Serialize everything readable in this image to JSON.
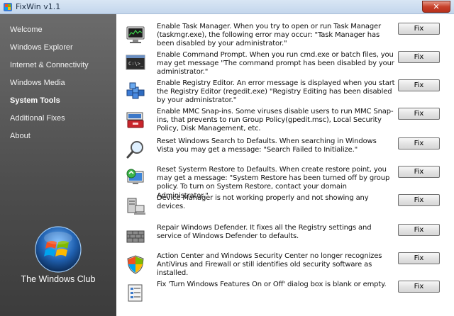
{
  "window": {
    "title": "FixWin v1.1",
    "close_label": "✕"
  },
  "sidebar": {
    "items": [
      {
        "label": "Welcome",
        "active": false
      },
      {
        "label": "Windows Explorer",
        "active": false
      },
      {
        "label": "Internet & Connectivity",
        "active": false
      },
      {
        "label": "Windows Media",
        "active": false
      },
      {
        "label": "System Tools",
        "active": true
      },
      {
        "label": "Additional Fixes",
        "active": false
      },
      {
        "label": "About",
        "active": false
      }
    ],
    "brand": "The Windows Club"
  },
  "fixes": [
    {
      "icon": "task-manager-icon",
      "text": "Enable Task Manager. When you try to open or run Task Manager (taskmgr.exe), the following error may occur: \"Task Manager has been disabled by your administrator.\"",
      "button": "Fix"
    },
    {
      "icon": "command-prompt-icon",
      "text": "Enable Command Prompt. When you run cmd.exe or batch files, you may get message \"The command prompt has been disabled by your administrator.\"",
      "button": "Fix"
    },
    {
      "icon": "registry-editor-icon",
      "text": "Enable Registry Editor. An error message is displayed when you start the Registry Editor (regedit.exe) \"Registry Editing has been disabled by your administrator.\"",
      "button": "Fix"
    },
    {
      "icon": "mmc-toolbox-icon",
      "text": "Enable MMC Snap-ins. Some viruses disable users to run MMC Snap-ins, that prevents to run Group Policy(gpedit.msc), Local Security Policy, Disk Management, etc.",
      "button": "Fix"
    },
    {
      "icon": "magnifier-icon",
      "text": "Reset Windows Search to Defaults. When searching in Windows Vista you may get a message: \"Search Failed to Initialize.\"",
      "button": "Fix"
    },
    {
      "icon": "system-restore-icon",
      "text": "Reset Systerm Restore to Defaults. When create restore point, you may get a message: \"System Restore has been turned off by group policy. To turn on System Restore, contact your domain Administrator.\"",
      "button": "Fix"
    },
    {
      "icon": "device-manager-icon",
      "text": "Device Manager is not working properly and not showing any devices.",
      "button": "Fix"
    },
    {
      "icon": "firewall-wall-icon",
      "text": "Repair Windows Defender. It fixes all the Registry settings and service of Windows Defender to defaults.",
      "button": "Fix"
    },
    {
      "icon": "security-shield-icon",
      "text": "Action Center and Windows Security Center no longer recognizes AntiVirus and Firewall or still identifies old security software as installed.",
      "button": "Fix"
    },
    {
      "icon": "windows-features-icon",
      "text": "Fix 'Turn Windows Features On or Off' dialog box is blank or empty.",
      "button": "Fix"
    }
  ],
  "colors": {
    "sidebar_top": "#6b6b6b",
    "sidebar_bottom": "#3c3c3c",
    "titlebar": "#c3d6ec",
    "close": "#c7412b"
  }
}
